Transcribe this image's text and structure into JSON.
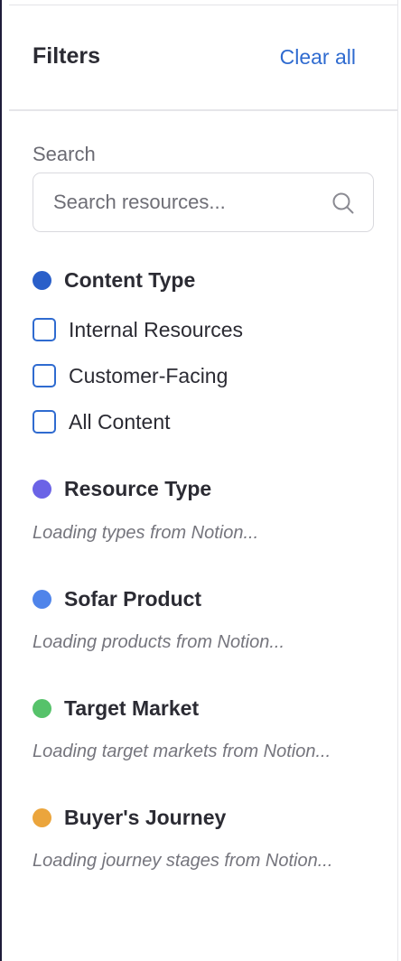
{
  "header": {
    "title": "Filters",
    "clear_all_label": "Clear all"
  },
  "search": {
    "label": "Search",
    "placeholder": "Search resources...",
    "value": ""
  },
  "sections": [
    {
      "title": "Content Type",
      "dot_color": "#2a5fc9",
      "options": [
        {
          "label": "Internal Resources",
          "checked": false
        },
        {
          "label": "Customer-Facing",
          "checked": false
        },
        {
          "label": "All Content",
          "checked": false
        }
      ]
    },
    {
      "title": "Resource Type",
      "dot_color": "#6b63e6",
      "loading_text": "Loading types from Notion..."
    },
    {
      "title": "Sofar Product",
      "dot_color": "#4f84ea",
      "loading_text": "Loading products from Notion..."
    },
    {
      "title": "Target Market",
      "dot_color": "#56c26a",
      "loading_text": "Loading target markets from Notion..."
    },
    {
      "title": "Buyer's Journey",
      "dot_color": "#eba53c",
      "loading_text": "Loading journey stages from Notion..."
    }
  ],
  "colors": {
    "accent": "#2f6bd0",
    "checkbox_border": "#2f6bd0"
  },
  "icons": {
    "search": "search-icon"
  }
}
